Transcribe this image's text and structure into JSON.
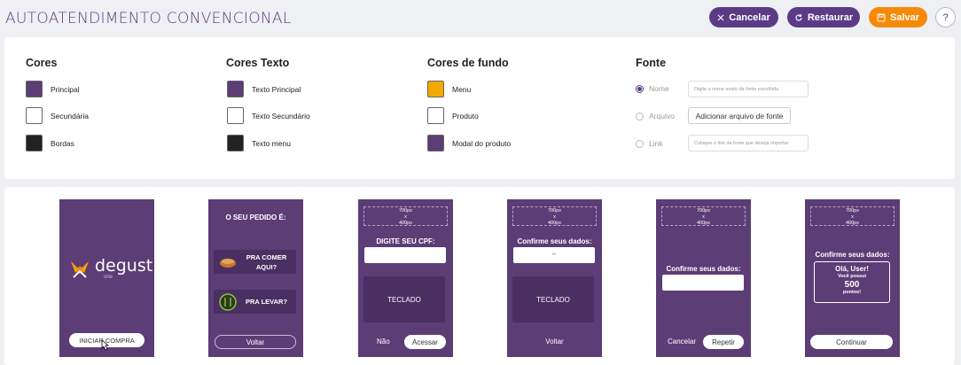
{
  "header": {
    "title": "AUTOATENDIMENTO CONVENCIONAL",
    "cancel": "Cancelar",
    "restore": "Restaurar",
    "save": "Salvar",
    "help": "?"
  },
  "colors": {
    "accent": "#5b3a86",
    "save": "#f58a07"
  },
  "cores": {
    "title": "Cores",
    "items": [
      {
        "label": "Principal",
        "color": "#5c3d76"
      },
      {
        "label": "Secundária",
        "color": "#ffffff"
      },
      {
        "label": "Bordas",
        "color": "#222222"
      }
    ]
  },
  "cores_texto": {
    "title": "Cores Texto",
    "items": [
      {
        "label": "Texto Principal",
        "color": "#5c3d76"
      },
      {
        "label": "Texto Secundário",
        "color": "#ffffff"
      },
      {
        "label": "Texto menu",
        "color": "#222222"
      }
    ]
  },
  "cores_fundo": {
    "title": "Cores de fundo",
    "items": [
      {
        "label": "Menu",
        "color": "#f5a800"
      },
      {
        "label": "Produto",
        "color": "#ffffff"
      },
      {
        "label": "Modal do produto",
        "color": "#5c3d76"
      }
    ]
  },
  "fonte": {
    "title": "Fonte",
    "nome_label": "Nome",
    "nome_placeholder": "Digite o nome exato da fonte escolhida",
    "arquivo_label": "Arquivo",
    "arquivo_button": "Adicionar arquivo de fonte",
    "link_label": "Link",
    "link_placeholder": "Coloque o link da fonte que deseja importar"
  },
  "preview": {
    "placeholder": "700px\nx\n400px",
    "s1": {
      "brand": "degust",
      "brand_sub": "one",
      "button": "INICIAR COMPRA"
    },
    "s2": {
      "title": "O SEU PEDIDO É:",
      "opt1": "PRA COMER AQUI?",
      "opt2": "PRA LEVAR?",
      "button": "Voltar"
    },
    "s3": {
      "title": "DIGITE SEU CPF:",
      "keyboard": "TECLADO",
      "no": "Não",
      "button": "Acessar"
    },
    "s4": {
      "title": "Confirme seus dados:",
      "value": "--",
      "keyboard": "TECLADO",
      "button": "Voltar"
    },
    "s5": {
      "title": "Confirme seus dados:",
      "cancel": "Cancelar",
      "button": "Repetir"
    },
    "s6": {
      "title": "Confirme seus dados:",
      "hello": "Olá, User!",
      "has": "Você possui",
      "points": "500",
      "points_label": "pontos!",
      "button": "Continuar"
    }
  }
}
